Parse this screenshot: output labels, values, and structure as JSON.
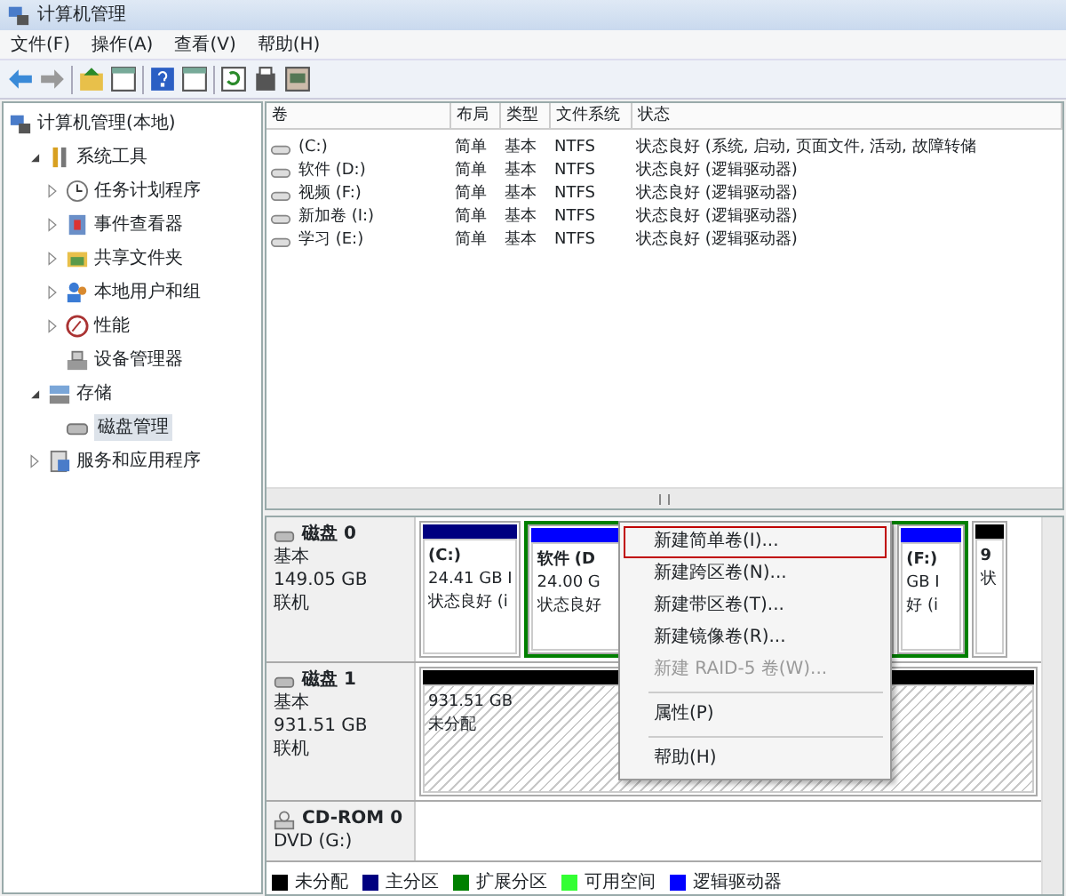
{
  "window": {
    "title": "计算机管理"
  },
  "menu": [
    "文件(F)",
    "操作(A)",
    "查看(V)",
    "帮助(H)"
  ],
  "toolbar": [
    {
      "kind": "back"
    },
    {
      "kind": "forward"
    },
    {
      "kind": "sep"
    },
    {
      "kind": "up"
    },
    {
      "kind": "pane"
    },
    {
      "kind": "sep"
    },
    {
      "kind": "help"
    },
    {
      "kind": "pane"
    },
    {
      "kind": "sep"
    },
    {
      "kind": "refresh"
    },
    {
      "kind": "properties"
    },
    {
      "kind": "export"
    }
  ],
  "tree": [
    {
      "label": "计算机管理(本地)",
      "kind": "computer",
      "selected": false,
      "children": [
        {
          "label": "系统工具",
          "kind": "tools",
          "expanded": true,
          "selected": false,
          "children": [
            {
              "label": "任务计划程序",
              "kind": "clock",
              "expanded": false,
              "selected": false
            },
            {
              "label": "事件查看器",
              "kind": "log",
              "expanded": false,
              "selected": false
            },
            {
              "label": "共享文件夹",
              "kind": "folder",
              "expanded": false,
              "selected": false
            },
            {
              "label": "本地用户和组",
              "kind": "users",
              "expanded": false,
              "selected": false
            },
            {
              "label": "性能",
              "kind": "gauge",
              "expanded": false,
              "selected": false
            },
            {
              "label": "设备管理器",
              "kind": "device",
              "selected": false
            }
          ]
        },
        {
          "label": "存储",
          "kind": "storage",
          "expanded": true,
          "selected": false,
          "children": [
            {
              "label": "磁盘管理",
              "kind": "disk",
              "selected": true
            }
          ]
        },
        {
          "label": "服务和应用程序",
          "kind": "services",
          "expanded": false,
          "selected": false
        }
      ]
    }
  ],
  "volumes": {
    "columns": [
      "卷",
      "布局",
      "类型",
      "文件系统",
      "状态"
    ],
    "rows": [
      {
        "name": "(C:)",
        "layout": "简单",
        "type": "基本",
        "fs": "NTFS",
        "status": "状态良好 (系统, 启动, 页面文件, 活动, 故障转储"
      },
      {
        "name": "软件 (D:)",
        "layout": "简单",
        "type": "基本",
        "fs": "NTFS",
        "status": "状态良好 (逻辑驱动器)"
      },
      {
        "name": "视频 (F:)",
        "layout": "简单",
        "type": "基本",
        "fs": "NTFS",
        "status": "状态良好 (逻辑驱动器)"
      },
      {
        "name": "新加卷 (I:)",
        "layout": "简单",
        "type": "基本",
        "fs": "NTFS",
        "status": "状态良好 (逻辑驱动器)"
      },
      {
        "name": "学习 (E:)",
        "layout": "简单",
        "type": "基本",
        "fs": "NTFS",
        "status": "状态良好 (逻辑驱动器)"
      }
    ]
  },
  "disks": [
    {
      "kind": "disk",
      "name": "磁盘 0",
      "lines": [
        "基本",
        "149.05 GB",
        "联机"
      ],
      "partitions": [
        {
          "color": "#000080",
          "extended": false,
          "unallocated": false,
          "lines": [
            "(C:)",
            "24.41 GB I",
            "状态良好 (i"
          ]
        },
        {
          "color": "#0000ff",
          "extended": true,
          "unallocated": false,
          "lines": [
            "软件 (D",
            "24.00 G",
            "状态良好"
          ]
        },
        {
          "color": "#0000ff",
          "extended": true,
          "unallocated": false,
          "lines": [
            "(F:)",
            "GB I",
            "好 (i"
          ]
        },
        {
          "color": "#000000",
          "extended": false,
          "unallocated": false,
          "lines": [
            "9",
            "状"
          ]
        }
      ]
    },
    {
      "kind": "disk",
      "name": "磁盘 1",
      "lines": [
        "基本",
        "931.51 GB",
        "联机"
      ],
      "partitions": [
        {
          "color": "#000000",
          "extended": false,
          "unallocated": true,
          "lines": [
            "931.51 GB",
            "未分配"
          ]
        }
      ]
    },
    {
      "kind": "cdrom",
      "name": "CD-ROM 0",
      "lines": [
        "DVD (G:)"
      ]
    }
  ],
  "legend": [
    {
      "label": "未分配",
      "color": "#000000"
    },
    {
      "label": "主分区",
      "color": "#000080"
    },
    {
      "label": "扩展分区",
      "color": "#008000"
    },
    {
      "label": "可用空间",
      "color": "#33ff33"
    },
    {
      "label": "逻辑驱动器",
      "color": "#0000ff"
    }
  ],
  "context_menu": [
    {
      "kind": "item",
      "label": "新建简单卷(I)...",
      "highlighted": true,
      "disabled": false
    },
    {
      "kind": "item",
      "label": "新建跨区卷(N)...",
      "highlighted": false,
      "disabled": false
    },
    {
      "kind": "item",
      "label": "新建带区卷(T)...",
      "highlighted": false,
      "disabled": false
    },
    {
      "kind": "item",
      "label": "新建镜像卷(R)...",
      "highlighted": false,
      "disabled": false
    },
    {
      "kind": "item",
      "label": "新建 RAID-5 卷(W)...",
      "highlighted": false,
      "disabled": true
    },
    {
      "kind": "separator"
    },
    {
      "kind": "item",
      "label": "属性(P)",
      "highlighted": false,
      "disabled": false
    },
    {
      "kind": "separator"
    },
    {
      "kind": "item",
      "label": "帮助(H)",
      "highlighted": false,
      "disabled": false
    }
  ]
}
